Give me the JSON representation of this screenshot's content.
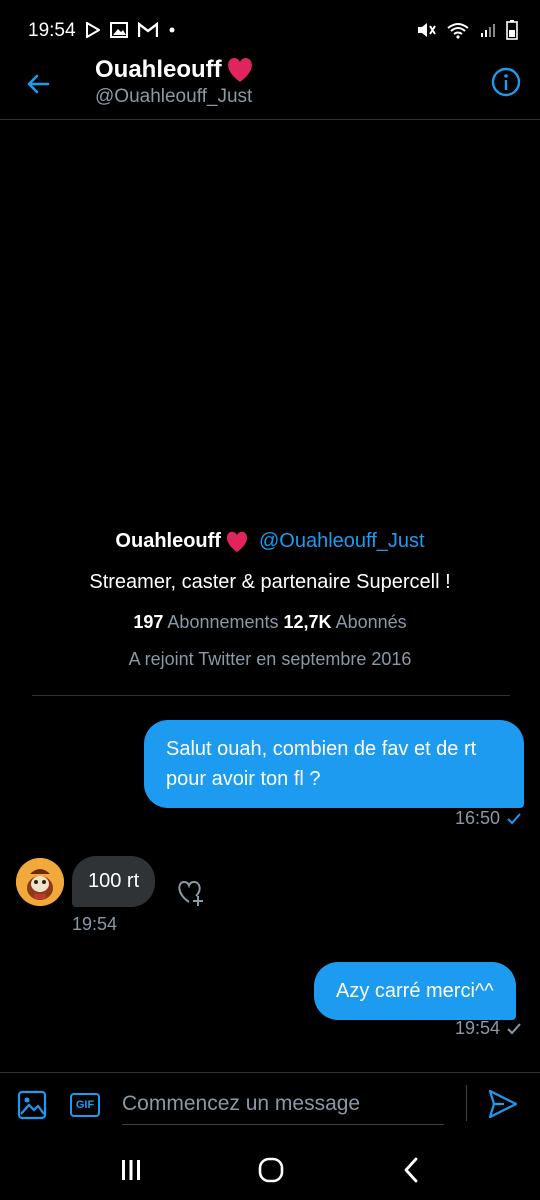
{
  "status_bar": {
    "time": "19:54",
    "left_icons": [
      "play-store-icon",
      "image-icon",
      "gmail-icon",
      "dot-icon"
    ],
    "right_icons": [
      "mute-icon",
      "wifi-icon",
      "signal-icon",
      "battery-icon"
    ]
  },
  "header": {
    "name": "Ouahleouff",
    "handle": "@Ouahleouff_Just"
  },
  "profile": {
    "name": "Ouahleouff",
    "handle": "@Ouahleouff_Just",
    "bio": "Streamer, caster & partenaire Supercell !",
    "following_count": "197",
    "following_label": "Abonnements",
    "followers_count": "12,7K",
    "followers_label": "Abonnés",
    "joined": "A rejoint Twitter en septembre 2016"
  },
  "messages": [
    {
      "direction": "out",
      "text": "Salut ouah, combien de fav et de rt pour avoir ton fl ?",
      "time": "16:50"
    },
    {
      "direction": "in",
      "text": "100 rt",
      "time": "19:54"
    },
    {
      "direction": "out",
      "text": "Azy carré merci^^",
      "time": "19:54"
    }
  ],
  "composer": {
    "placeholder": "Commencez un message",
    "gif_label": "GIF"
  },
  "colors": {
    "accent": "#1d9bf0",
    "background": "#000000",
    "incoming_bubble": "#2f3336",
    "secondary_text": "#8b98a5",
    "heart": "#e0245e"
  }
}
